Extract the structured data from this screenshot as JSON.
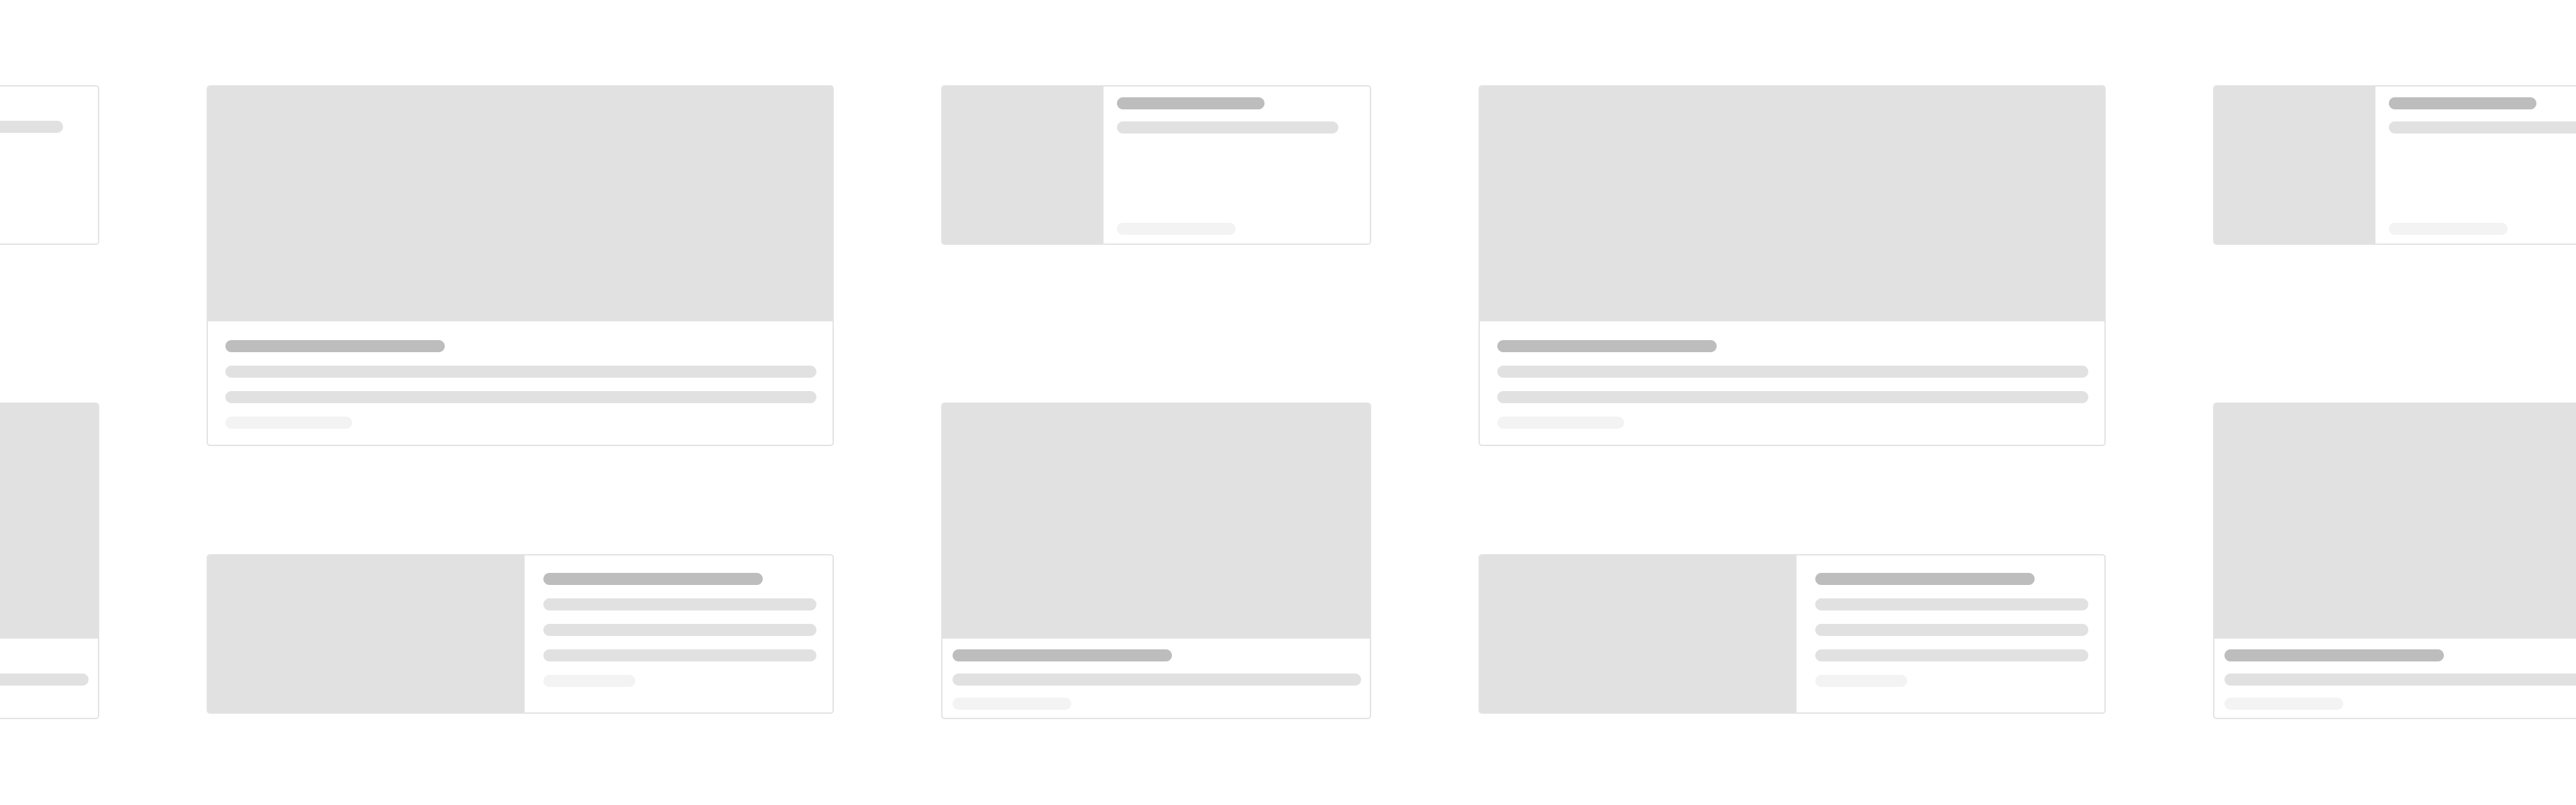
{
  "page": {
    "description_free": true,
    "background_color": "#ffffff"
  },
  "colors": {
    "card_background": "#ffffff",
    "card_border": "#e3e3e3",
    "media_placeholder": "#e1e1e1",
    "title_placeholder": "#bdbdbd",
    "line_placeholder": "#e1e1e1",
    "meta_placeholder": "#f3f3f3"
  },
  "cards": [
    {
      "id": "card-1",
      "layout": "horizontal-thumbnail",
      "state": "loading-skeleton"
    },
    {
      "id": "card-2",
      "layout": "vertical-image-top",
      "state": "loading-skeleton"
    },
    {
      "id": "card-3",
      "layout": "vertical-image-top",
      "state": "loading-skeleton"
    },
    {
      "id": "card-4",
      "layout": "horizontal-thumbnail",
      "state": "loading-skeleton"
    },
    {
      "id": "card-5",
      "layout": "horizontal-thumbnail",
      "state": "loading-skeleton"
    },
    {
      "id": "card-6",
      "layout": "vertical-image-top",
      "state": "loading-skeleton"
    },
    {
      "id": "card-7",
      "layout": "vertical-image-top",
      "state": "loading-skeleton"
    },
    {
      "id": "card-8",
      "layout": "horizontal-thumbnail",
      "state": "loading-skeleton"
    },
    {
      "id": "card-9",
      "layout": "horizontal-thumbnail",
      "state": "loading-skeleton"
    },
    {
      "id": "card-10",
      "layout": "vertical-image-top",
      "state": "loading-skeleton"
    }
  ]
}
